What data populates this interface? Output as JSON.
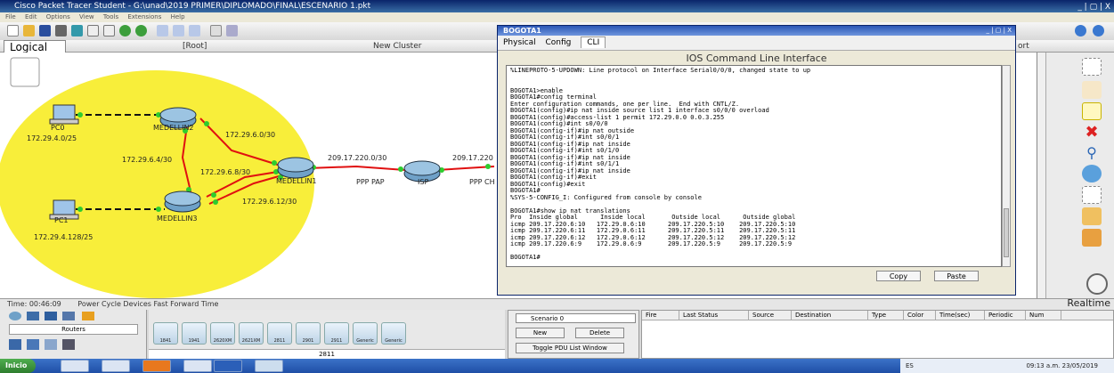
{
  "window": {
    "title": "Cisco Packet Tracer Student - G:\\unad\\2019 PRIMER\\DIPLOMADO\\FINAL\\ESCENARIO 1.pkt",
    "controls": "_ | ▢ | X"
  },
  "menu": [
    "File",
    "Edit",
    "Options",
    "View",
    "Tools",
    "Extensions",
    "Help"
  ],
  "workspace": {
    "logical_tab": "Logical",
    "root_label": "[Root]",
    "cluster_label": "New Cluster",
    "port_label": "ort"
  },
  "network": {
    "devices": [
      {
        "name": "PC0",
        "type": "pc"
      },
      {
        "name": "PC1",
        "type": "pc"
      },
      {
        "name": "MEDELLIN2",
        "type": "router"
      },
      {
        "name": "MEDELLIN3",
        "type": "router"
      },
      {
        "name": "MEDELLIN1",
        "type": "router"
      },
      {
        "name": "ISP",
        "type": "router"
      }
    ],
    "labels": [
      "172.29.4.0/25",
      "172.29.6.0/30",
      "172.29.6.4/30",
      "172.29.6.8/30",
      "172.29.6.12/30",
      "172.29.4.128/25",
      "209.17.220.0/30",
      "209.17.220",
      "PPP PAP",
      "PPP CH"
    ],
    "colors": {
      "cluster": "#f8ee3a",
      "serial": "#e01010",
      "ethernet": "#111111",
      "link_up": "#2ecc2e"
    }
  },
  "cli_window": {
    "title": "BOGOTA1",
    "controls": "_ | ▢ | X",
    "tabs": [
      "Physical",
      "Config",
      "CLI"
    ],
    "active_tab": "CLI",
    "heading": "IOS Command Line Interface",
    "console_lines": [
      "%LINEPROTO-5-UPDOWN: Line protocol on Interface Serial0/0/0, changed state to up",
      "",
      "",
      "BOGOTA1>enable",
      "BOGOTA1#config terminal",
      "Enter configuration commands, one per line.  End with CNTL/Z.",
      "BOGOTA1(config)#ip nat inside source list 1 interface s0/0/0 overload",
      "BOGOTA1(config)#access-list 1 permit 172.29.0.0 0.0.3.255",
      "BOGOTA1(config)#int s0/0/0",
      "BOGOTA1(config-if)#ip nat outside",
      "BOGOTA1(config-if)#int s0/0/1",
      "BOGOTA1(config-if)#ip nat inside",
      "BOGOTA1(config-if)#int s0/1/0",
      "BOGOTA1(config-if)#ip nat inside",
      "BOGOTA1(config-if)#int s0/1/1",
      "BOGOTA1(config-if)#ip nat inside",
      "BOGOTA1(config-if)#exit",
      "BOGOTA1(config)#exit",
      "BOGOTA1#",
      "%SYS-5-CONFIG_I: Configured from console by console",
      "",
      "BOGOTA1#show ip nat translations",
      "Pro  Inside global      Inside local       Outside local      Outside global",
      "icmp 209.17.220.6:10   172.29.0.6:10      209.17.220.5:10    209.17.220.5:10",
      "icmp 209.17.220.6:11   172.29.0.6:11      209.17.220.5:11    209.17.220.5:11",
      "icmp 209.17.220.6:12   172.29.0.6:12      209.17.220.5:12    209.17.220.5:12",
      "icmp 209.17.220.6:9    172.29.0.6:9       209.17.220.5:9     209.17.220.5:9",
      "",
      "BOGOTA1#"
    ],
    "copy_button": "Copy",
    "paste_button": "Paste"
  },
  "timebar": {
    "time": "Time: 00:46:09",
    "actions": "Power Cycle Devices  Fast Forward Time",
    "mode": "Realtime"
  },
  "devices_panel": {
    "category": "Routers",
    "models": [
      "1841",
      "1941",
      "2620XM",
      "2621XM",
      "2811",
      "2901",
      "2911",
      "Generic",
      "Generic"
    ],
    "selected_model": "2811"
  },
  "scenario": {
    "selected": "Scenario 0",
    "new_label": "New",
    "delete_label": "Delete",
    "toggle_label": "Toggle PDU List Window"
  },
  "pdu_table": {
    "columns": [
      "Fire",
      "Last Status",
      "Source",
      "Destination",
      "Type",
      "Color",
      "Time(sec)",
      "Periodic",
      "Num"
    ]
  },
  "taskbar": {
    "start_label": "Inicio",
    "language": "ES",
    "time": "09:13 a.m.",
    "date": "23/05/2019"
  }
}
